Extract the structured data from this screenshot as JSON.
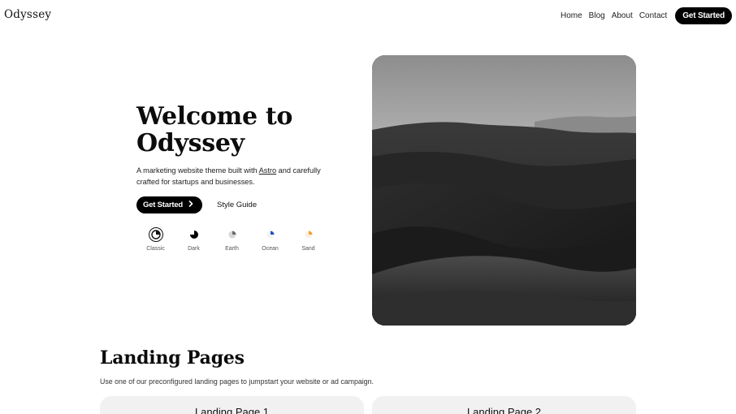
{
  "header": {
    "logo": "Odyssey",
    "nav": [
      "Home",
      "Blog",
      "About",
      "Contact"
    ],
    "cta": "Get Started"
  },
  "hero": {
    "title_line1": "Welcome to",
    "title_line2": "Odyssey",
    "description_before": "A marketing website theme built with ",
    "description_link": "Astro",
    "description_after": " and carefully crafted for startups and businesses.",
    "primary_button": "Get Started",
    "primary_button_icon": "chevron-right-icon",
    "secondary_button": "Style Guide",
    "image_alt": "desert-dunes-photo"
  },
  "themes": [
    {
      "label": "Classic",
      "color": "#111111",
      "active": true
    },
    {
      "label": "Dark",
      "color": "#000000",
      "active": false
    },
    {
      "label": "Earth",
      "color": "#6b6b6b",
      "active": false
    },
    {
      "label": "Ocean",
      "color": "#1f4fc4",
      "active": false
    },
    {
      "label": "Sand",
      "color": "#f0a230",
      "active": false
    }
  ],
  "section": {
    "title": "Landing Pages",
    "description": "Use one of our preconfigured landing pages to jumpstart your website or ad campaign."
  },
  "cards": [
    {
      "title": "Landing Page 1"
    },
    {
      "title": "Landing Page 2"
    }
  ]
}
